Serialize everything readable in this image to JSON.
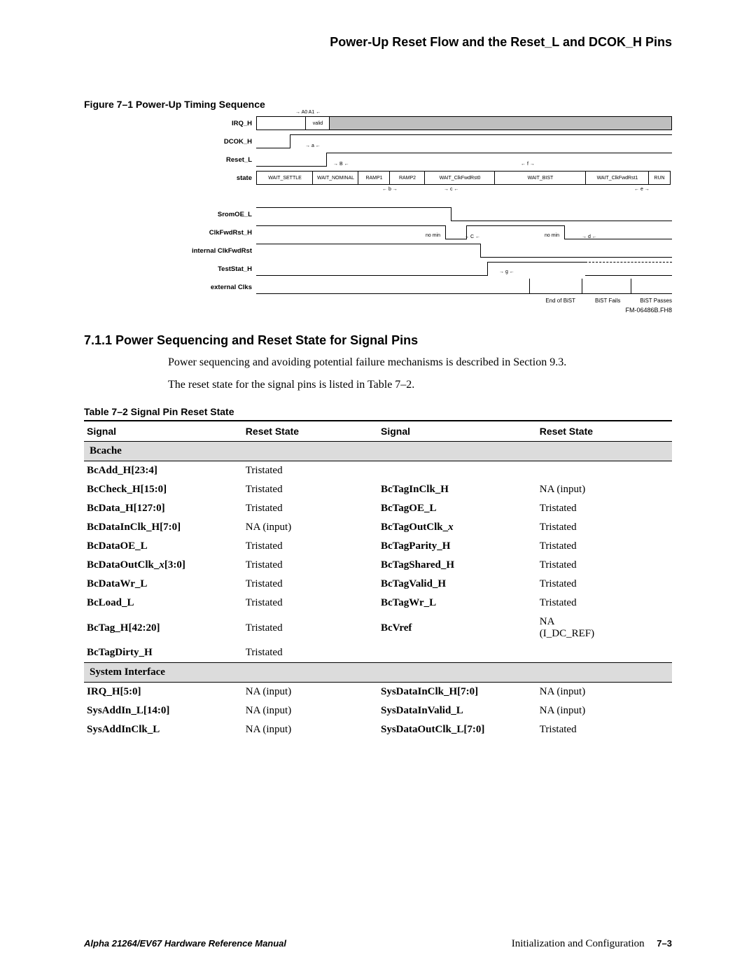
{
  "header": {
    "running": "Power-Up Reset Flow and the Reset_L and DCOK_H Pins"
  },
  "figure": {
    "caption": "Figure 7–1  Power-Up Timing Sequence",
    "diagram_id": "FM-06486B.FH8",
    "end_labels": [
      "End of BiST",
      "BiST Fails",
      "BiST Passes"
    ],
    "signals": [
      {
        "name": "IRQ_H"
      },
      {
        "name": "DCOK_H"
      },
      {
        "name": "Reset_L"
      },
      {
        "name": "state"
      },
      {
        "name": ""
      },
      {
        "name": "SromOE_L"
      },
      {
        "name": "ClkFwdRst_H"
      },
      {
        "name": "internal ClkFwdRst"
      },
      {
        "name": "TestStat_H"
      },
      {
        "name": "external Clks"
      }
    ],
    "tags": {
      "a0a1": "A0 A1",
      "valid": "valid",
      "a": "a",
      "B": "B",
      "b": "b",
      "c": "c",
      "C": "C",
      "d": "d",
      "e": "e",
      "f": "f",
      "g": "g",
      "nomin": "no min"
    },
    "states": [
      "WAIT_SETTLE",
      "WAIT_NOMINAL",
      "RAMP1",
      "RAMP2",
      "WAIT_ClkFwdRst0",
      "WAIT_BIST",
      "WAIT_ClkFwdRst1",
      "RUN"
    ]
  },
  "section": {
    "heading": "7.1.1  Power Sequencing and Reset State for Signal Pins",
    "p1": "Power sequencing and avoiding potential failure mechanisms is described in Section 9.3.",
    "p2": "The reset state for the signal pins is listed in Table 7–2."
  },
  "table": {
    "caption": "Table 7–2  Signal Pin Reset State",
    "headers": [
      "Signal",
      "Reset State",
      "Signal",
      "Reset State"
    ],
    "groups": [
      {
        "title": "Bcache",
        "rows": [
          [
            "BcAdd_H[23:4]",
            "Tristated",
            "",
            ""
          ],
          [
            "BcCheck_H[15:0]",
            "Tristated",
            "BcTagInClk_H",
            "NA (input)"
          ],
          [
            "BcData_H[127:0]",
            "Tristated",
            "BcTagOE_L",
            "Tristated"
          ],
          [
            "BcDataInClk_H[7:0]",
            "NA (input)",
            "BcTagOutClk_x",
            "Tristated"
          ],
          [
            "BcDataOE_L",
            "Tristated",
            "BcTagParity_H",
            "Tristated"
          ],
          [
            "BcDataOutClk_x[3:0]",
            "Tristated",
            "BcTagShared_H",
            "Tristated"
          ],
          [
            "BcDataWr_L",
            "Tristated",
            "BcTagValid_H",
            "Tristated"
          ],
          [
            "BcLoad_L",
            "Tristated",
            "BcTagWr_L",
            "Tristated"
          ],
          [
            "BcTag_H[42:20]",
            "Tristated",
            "BcVref",
            "NA (I_DC_REF)"
          ],
          [
            "BcTagDirty_H",
            "Tristated",
            "",
            ""
          ]
        ]
      },
      {
        "title": "System Interface",
        "rows": [
          [
            "IRQ_H[5:0]",
            "NA (input)",
            "SysDataInClk_H[7:0]",
            "NA (input)"
          ],
          [
            "SysAddIn_L[14:0]",
            "NA (input)",
            "SysDataInValid_L",
            "NA (input)"
          ],
          [
            "SysAddInClk_L",
            "NA (input)",
            "SysDataOutClk_L[7:0]",
            "Tristated"
          ]
        ]
      }
    ]
  },
  "footer": {
    "left": "Alpha 21264/EV67 Hardware Reference Manual",
    "right_label": "Initialization and Configuration",
    "page": "7–3"
  }
}
